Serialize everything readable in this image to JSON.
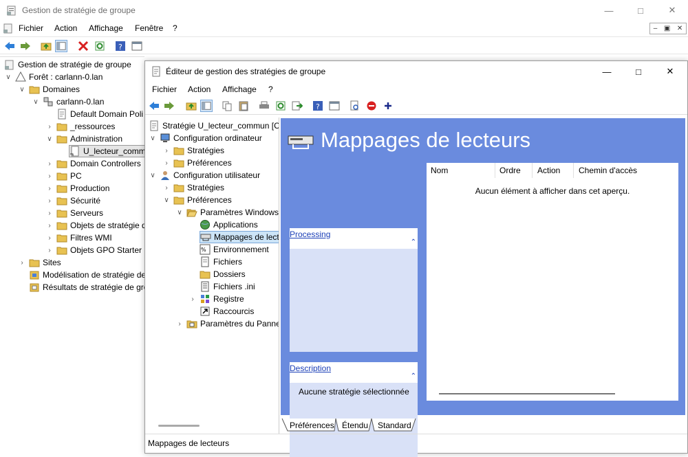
{
  "outer": {
    "title": "Gestion de stratégie de groupe",
    "menu": [
      "Fichier",
      "Action",
      "Affichage",
      "Fenêtre",
      "?"
    ],
    "tree": [
      {
        "label": "Gestion de stratégie de groupe",
        "icon": "gpm-root-icon"
      },
      {
        "label": "Forêt : carlann-0.lan",
        "icon": "forest-icon"
      },
      {
        "label": "Domaines",
        "icon": "folder-icon"
      },
      {
        "label": "carlann-0.lan",
        "icon": "domain-icon"
      },
      {
        "label": "Default Domain Poli",
        "icon": "gpo-icon"
      },
      {
        "label": "_ressources",
        "icon": "folder-icon"
      },
      {
        "label": "Administration",
        "icon": "folder-icon"
      },
      {
        "label": "U_lecteur_comm",
        "icon": "gpo-link-icon"
      },
      {
        "label": "Domain Controllers",
        "icon": "folder-icon"
      },
      {
        "label": "PC",
        "icon": "folder-icon"
      },
      {
        "label": "Production",
        "icon": "folder-icon"
      },
      {
        "label": "Sécurité",
        "icon": "folder-icon"
      },
      {
        "label": "Serveurs",
        "icon": "folder-icon"
      },
      {
        "label": "Objets de stratégie d",
        "icon": "folder-icon"
      },
      {
        "label": "Filtres WMI",
        "icon": "folder-icon"
      },
      {
        "label": "Objets GPO Starter",
        "icon": "folder-icon"
      },
      {
        "label": "Sites",
        "icon": "folder-icon"
      },
      {
        "label": "Modélisation de stratégie de",
        "icon": "modeling-icon"
      },
      {
        "label": "Résultats de stratégie de gro",
        "icon": "results-icon"
      }
    ]
  },
  "inner": {
    "title": "Éditeur de gestion des stratégies de groupe",
    "menu": [
      "Fichier",
      "Action",
      "Affichage",
      "?"
    ],
    "tree": [
      {
        "label": "Stratégie U_lecteur_commun [C",
        "icon": "policy-icon"
      },
      {
        "label": "Configuration ordinateur",
        "icon": "computer-icon"
      },
      {
        "label": "Stratégies",
        "icon": "folder-icon"
      },
      {
        "label": "Préférences",
        "icon": "folder-icon"
      },
      {
        "label": "Configuration utilisateur",
        "icon": "user-icon"
      },
      {
        "label": "Stratégies",
        "icon": "folder-icon"
      },
      {
        "label": "Préférences",
        "icon": "folder-icon"
      },
      {
        "label": "Paramètres Windows",
        "icon": "folder-open-icon"
      },
      {
        "label": "Applications",
        "icon": "globe-icon"
      },
      {
        "label": "Mappages de lect",
        "icon": "drive-map-icon"
      },
      {
        "label": "Environnement",
        "icon": "environment-icon"
      },
      {
        "label": "Fichiers",
        "icon": "files-icon"
      },
      {
        "label": "Dossiers",
        "icon": "folder-icon"
      },
      {
        "label": "Fichiers .ini",
        "icon": "ini-icon"
      },
      {
        "label": "Registre",
        "icon": "registry-icon"
      },
      {
        "label": "Raccourcis",
        "icon": "shortcut-icon"
      },
      {
        "label": "Paramètres du Panne",
        "icon": "control-panel-icon"
      }
    ],
    "content": {
      "title": "Mappages de lecteurs",
      "processing_label": "Processing",
      "description_label": "Description",
      "description_text": "Aucune stratégie sélectionnée",
      "columns": [
        "Nom",
        "Ordre",
        "Action",
        "Chemin d'accès"
      ],
      "empty_message": "Aucun élément à afficher dans cet aperçu."
    },
    "tabs": [
      "Préférences",
      "Étendu",
      "Standard"
    ],
    "status": "Mappages de lecteurs"
  },
  "colors": {
    "content_bg": "#6a8bde",
    "panel_bg": "#d9e1f7",
    "link": "#1b3fb7"
  }
}
